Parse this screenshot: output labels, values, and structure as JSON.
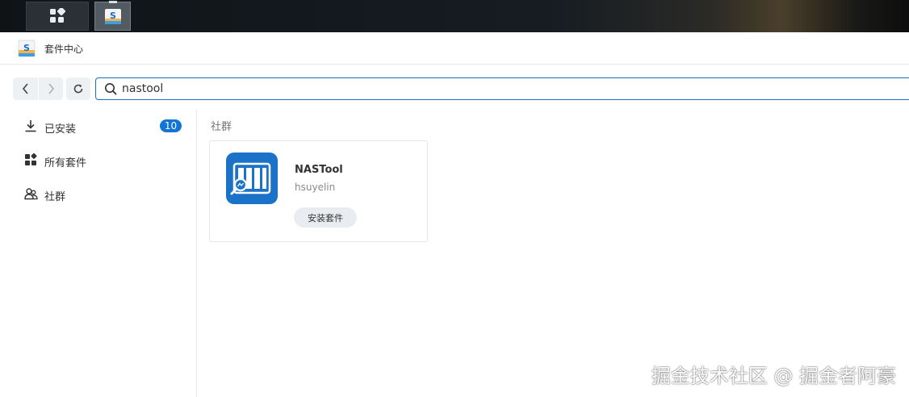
{
  "taskbar": {
    "main_menu_icon": "grid-icon",
    "active_app_icon": "package-center-icon"
  },
  "window": {
    "title": "套件中心",
    "app_icon": "package-center-icon"
  },
  "toolbar": {
    "back_icon": "chevron-left-icon",
    "forward_icon": "chevron-right-icon",
    "refresh_icon": "refresh-icon",
    "search": {
      "value": "nastool",
      "icon": "search-icon"
    }
  },
  "sidebar": {
    "items": [
      {
        "label": "已安装",
        "icon": "download-icon",
        "badge": "10"
      },
      {
        "label": "所有套件",
        "icon": "grid-icon"
      },
      {
        "label": "社群",
        "icon": "community-icon"
      }
    ]
  },
  "main": {
    "section_title": "社群",
    "packages": [
      {
        "name": "NASTool",
        "author": "hsuyelin",
        "action": "安装套件",
        "icon": "nastool-icon"
      }
    ]
  },
  "watermark": "掘金技术社区 @ 掘金者阿豪",
  "colors": {
    "accent": "#1274d4",
    "search_border": "#1a6ec8",
    "package_icon_bg": "#1a73c9"
  }
}
